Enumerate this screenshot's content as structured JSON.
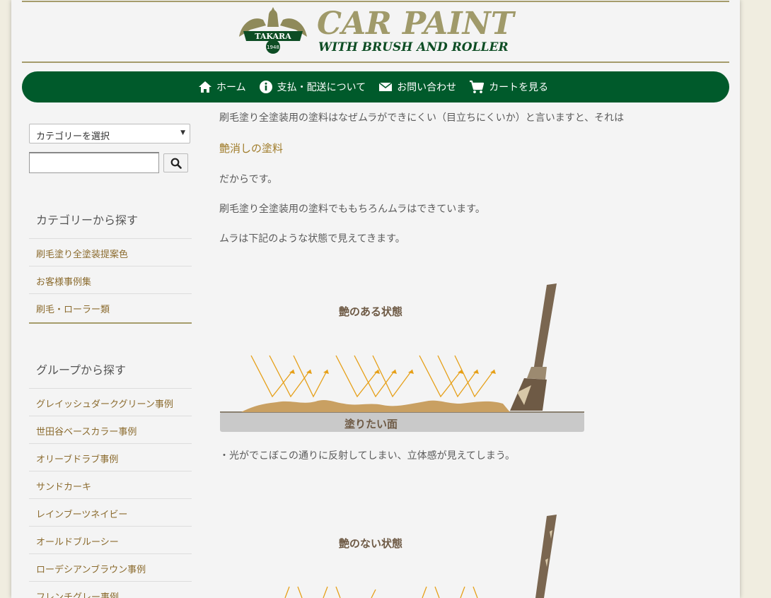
{
  "colors": {
    "nav_bg": "#005a2b",
    "gold": "#a59c6b",
    "link": "#8b6b2e",
    "emphasis": "#a07c2a"
  },
  "logo": {
    "brand": "CAR PAINT",
    "tagline": "WITH BRUSH AND ROLLER",
    "emblem_text": "TAKARA",
    "emblem_year": "1948"
  },
  "nav": [
    {
      "label": "ホーム",
      "icon": "home-icon"
    },
    {
      "label": "支払・配送について",
      "icon": "info-icon"
    },
    {
      "label": "お問い合わせ",
      "icon": "mail-icon"
    },
    {
      "label": "カートを見る",
      "icon": "cart-icon"
    }
  ],
  "sidebar": {
    "category_select": "カテゴリーを選択",
    "search_placeholder": "",
    "category_heading": "カテゴリーから探す",
    "categories": [
      "刷毛塗り全塗装提案色",
      "お客様事例集",
      "刷毛・ローラー類"
    ],
    "group_heading": "グループから探す",
    "groups": [
      "グレイッシュダークグリーン事例",
      "世田谷ベースカラー事例",
      "オリーブドラブ事例",
      "サンドカーキ",
      "レインブーツネイビー",
      "オールドブルーシー",
      "ローデシアンブラウン事例",
      "フレンチグレー事例"
    ]
  },
  "main": {
    "p1": "刷毛塗り全塗装用の塗料はなぜムラができにくい（目立ちにくいか）と言いますと、それは",
    "emphasis": "艶消しの塗料",
    "p2": "だからです。",
    "p3": "刷毛塗り全塗装用の塗料でももちろんムラはできています。",
    "p4": "ムラは下記のような状態で見えてきます。",
    "diagram1_title": "艶のある状態",
    "diagram1_surface": "塗りたい面",
    "caption1": "・光がでこぼこの通りに反射してしまい、立体感が見えてしまう。",
    "diagram2_title": "艶のない状態"
  }
}
